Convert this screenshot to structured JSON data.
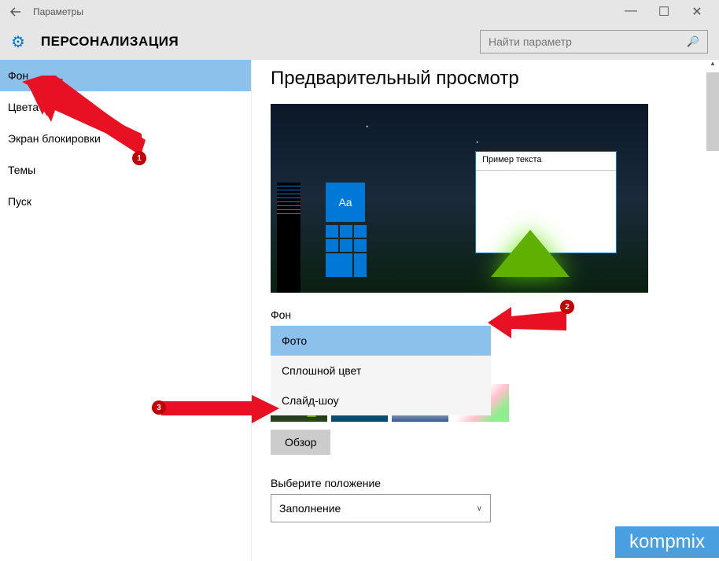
{
  "titlebar": {
    "title": "Параметры"
  },
  "header": {
    "title": "ПЕРСОНАЛИЗАЦИЯ"
  },
  "search": {
    "placeholder": "Найти параметр"
  },
  "sidebar": {
    "items": [
      {
        "label": "Фон"
      },
      {
        "label": "Цвета"
      },
      {
        "label": "Экран блокировки"
      },
      {
        "label": "Темы"
      },
      {
        "label": "Пуск"
      }
    ]
  },
  "content": {
    "preview_title": "Предварительный просмотр",
    "preview_sample_text": "Пример текста",
    "preview_aa": "Aa",
    "bg_label": "Фон",
    "bg_options": [
      {
        "label": "Фото"
      },
      {
        "label": "Сплошной цвет"
      },
      {
        "label": "Слайд-шоу"
      }
    ],
    "browse": "Обзор",
    "fit_label": "Выберите положение",
    "fit_value": "Заполнение"
  },
  "annotations": {
    "b1": "1",
    "b2": "2",
    "b3": "3"
  },
  "watermark": "kompmix"
}
